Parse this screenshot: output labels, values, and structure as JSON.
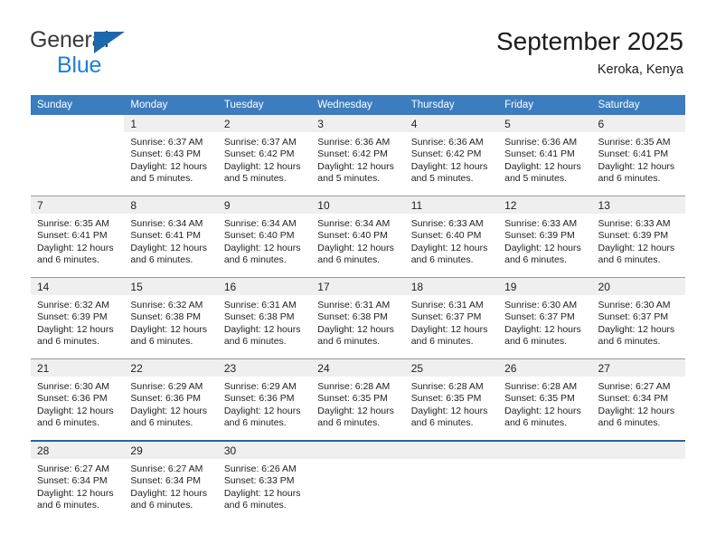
{
  "brand": {
    "name_part1": "General",
    "name_part2": "Blue",
    "logo_icon": "triangle-logo"
  },
  "header": {
    "title": "September 2025",
    "location": "Keroka, Kenya"
  },
  "colors": {
    "header_blue": "#3b7dbf",
    "brand_blue": "#1e7fd4",
    "logo_blue": "#1b68b0",
    "daynum_band": "#efefef",
    "row_divider": "#9a9a9a",
    "last_row_divider": "#2463a8"
  },
  "weekday_headers": [
    "Sunday",
    "Monday",
    "Tuesday",
    "Wednesday",
    "Thursday",
    "Friday",
    "Saturday"
  ],
  "weeks": [
    [
      {
        "day": "",
        "blank": true,
        "sunrise": "",
        "sunset": "",
        "daylight_line1": "",
        "daylight_line2": ""
      },
      {
        "day": "1",
        "sunrise": "Sunrise: 6:37 AM",
        "sunset": "Sunset: 6:43 PM",
        "daylight_line1": "Daylight: 12 hours",
        "daylight_line2": "and 5 minutes."
      },
      {
        "day": "2",
        "sunrise": "Sunrise: 6:37 AM",
        "sunset": "Sunset: 6:42 PM",
        "daylight_line1": "Daylight: 12 hours",
        "daylight_line2": "and 5 minutes."
      },
      {
        "day": "3",
        "sunrise": "Sunrise: 6:36 AM",
        "sunset": "Sunset: 6:42 PM",
        "daylight_line1": "Daylight: 12 hours",
        "daylight_line2": "and 5 minutes."
      },
      {
        "day": "4",
        "sunrise": "Sunrise: 6:36 AM",
        "sunset": "Sunset: 6:42 PM",
        "daylight_line1": "Daylight: 12 hours",
        "daylight_line2": "and 5 minutes."
      },
      {
        "day": "5",
        "sunrise": "Sunrise: 6:36 AM",
        "sunset": "Sunset: 6:41 PM",
        "daylight_line1": "Daylight: 12 hours",
        "daylight_line2": "and 5 minutes."
      },
      {
        "day": "6",
        "sunrise": "Sunrise: 6:35 AM",
        "sunset": "Sunset: 6:41 PM",
        "daylight_line1": "Daylight: 12 hours",
        "daylight_line2": "and 6 minutes."
      }
    ],
    [
      {
        "day": "7",
        "sunrise": "Sunrise: 6:35 AM",
        "sunset": "Sunset: 6:41 PM",
        "daylight_line1": "Daylight: 12 hours",
        "daylight_line2": "and 6 minutes."
      },
      {
        "day": "8",
        "sunrise": "Sunrise: 6:34 AM",
        "sunset": "Sunset: 6:41 PM",
        "daylight_line1": "Daylight: 12 hours",
        "daylight_line2": "and 6 minutes."
      },
      {
        "day": "9",
        "sunrise": "Sunrise: 6:34 AM",
        "sunset": "Sunset: 6:40 PM",
        "daylight_line1": "Daylight: 12 hours",
        "daylight_line2": "and 6 minutes."
      },
      {
        "day": "10",
        "sunrise": "Sunrise: 6:34 AM",
        "sunset": "Sunset: 6:40 PM",
        "daylight_line1": "Daylight: 12 hours",
        "daylight_line2": "and 6 minutes."
      },
      {
        "day": "11",
        "sunrise": "Sunrise: 6:33 AM",
        "sunset": "Sunset: 6:40 PM",
        "daylight_line1": "Daylight: 12 hours",
        "daylight_line2": "and 6 minutes."
      },
      {
        "day": "12",
        "sunrise": "Sunrise: 6:33 AM",
        "sunset": "Sunset: 6:39 PM",
        "daylight_line1": "Daylight: 12 hours",
        "daylight_line2": "and 6 minutes."
      },
      {
        "day": "13",
        "sunrise": "Sunrise: 6:33 AM",
        "sunset": "Sunset: 6:39 PM",
        "daylight_line1": "Daylight: 12 hours",
        "daylight_line2": "and 6 minutes."
      }
    ],
    [
      {
        "day": "14",
        "sunrise": "Sunrise: 6:32 AM",
        "sunset": "Sunset: 6:39 PM",
        "daylight_line1": "Daylight: 12 hours",
        "daylight_line2": "and 6 minutes."
      },
      {
        "day": "15",
        "sunrise": "Sunrise: 6:32 AM",
        "sunset": "Sunset: 6:38 PM",
        "daylight_line1": "Daylight: 12 hours",
        "daylight_line2": "and 6 minutes."
      },
      {
        "day": "16",
        "sunrise": "Sunrise: 6:31 AM",
        "sunset": "Sunset: 6:38 PM",
        "daylight_line1": "Daylight: 12 hours",
        "daylight_line2": "and 6 minutes."
      },
      {
        "day": "17",
        "sunrise": "Sunrise: 6:31 AM",
        "sunset": "Sunset: 6:38 PM",
        "daylight_line1": "Daylight: 12 hours",
        "daylight_line2": "and 6 minutes."
      },
      {
        "day": "18",
        "sunrise": "Sunrise: 6:31 AM",
        "sunset": "Sunset: 6:37 PM",
        "daylight_line1": "Daylight: 12 hours",
        "daylight_line2": "and 6 minutes."
      },
      {
        "day": "19",
        "sunrise": "Sunrise: 6:30 AM",
        "sunset": "Sunset: 6:37 PM",
        "daylight_line1": "Daylight: 12 hours",
        "daylight_line2": "and 6 minutes."
      },
      {
        "day": "20",
        "sunrise": "Sunrise: 6:30 AM",
        "sunset": "Sunset: 6:37 PM",
        "daylight_line1": "Daylight: 12 hours",
        "daylight_line2": "and 6 minutes."
      }
    ],
    [
      {
        "day": "21",
        "sunrise": "Sunrise: 6:30 AM",
        "sunset": "Sunset: 6:36 PM",
        "daylight_line1": "Daylight: 12 hours",
        "daylight_line2": "and 6 minutes."
      },
      {
        "day": "22",
        "sunrise": "Sunrise: 6:29 AM",
        "sunset": "Sunset: 6:36 PM",
        "daylight_line1": "Daylight: 12 hours",
        "daylight_line2": "and 6 minutes."
      },
      {
        "day": "23",
        "sunrise": "Sunrise: 6:29 AM",
        "sunset": "Sunset: 6:36 PM",
        "daylight_line1": "Daylight: 12 hours",
        "daylight_line2": "and 6 minutes."
      },
      {
        "day": "24",
        "sunrise": "Sunrise: 6:28 AM",
        "sunset": "Sunset: 6:35 PM",
        "daylight_line1": "Daylight: 12 hours",
        "daylight_line2": "and 6 minutes."
      },
      {
        "day": "25",
        "sunrise": "Sunrise: 6:28 AM",
        "sunset": "Sunset: 6:35 PM",
        "daylight_line1": "Daylight: 12 hours",
        "daylight_line2": "and 6 minutes."
      },
      {
        "day": "26",
        "sunrise": "Sunrise: 6:28 AM",
        "sunset": "Sunset: 6:35 PM",
        "daylight_line1": "Daylight: 12 hours",
        "daylight_line2": "and 6 minutes."
      },
      {
        "day": "27",
        "sunrise": "Sunrise: 6:27 AM",
        "sunset": "Sunset: 6:34 PM",
        "daylight_line1": "Daylight: 12 hours",
        "daylight_line2": "and 6 minutes."
      }
    ],
    [
      {
        "day": "28",
        "sunrise": "Sunrise: 6:27 AM",
        "sunset": "Sunset: 6:34 PM",
        "daylight_line1": "Daylight: 12 hours",
        "daylight_line2": "and 6 minutes."
      },
      {
        "day": "29",
        "sunrise": "Sunrise: 6:27 AM",
        "sunset": "Sunset: 6:34 PM",
        "daylight_line1": "Daylight: 12 hours",
        "daylight_line2": "and 6 minutes."
      },
      {
        "day": "30",
        "sunrise": "Sunrise: 6:26 AM",
        "sunset": "Sunset: 6:33 PM",
        "daylight_line1": "Daylight: 12 hours",
        "daylight_line2": "and 6 minutes."
      },
      {
        "day": "",
        "empty": true,
        "sunrise": "",
        "sunset": "",
        "daylight_line1": "",
        "daylight_line2": ""
      },
      {
        "day": "",
        "empty": true,
        "sunrise": "",
        "sunset": "",
        "daylight_line1": "",
        "daylight_line2": ""
      },
      {
        "day": "",
        "empty": true,
        "sunrise": "",
        "sunset": "",
        "daylight_line1": "",
        "daylight_line2": ""
      },
      {
        "day": "",
        "empty": true,
        "sunrise": "",
        "sunset": "",
        "daylight_line1": "",
        "daylight_line2": ""
      }
    ]
  ]
}
